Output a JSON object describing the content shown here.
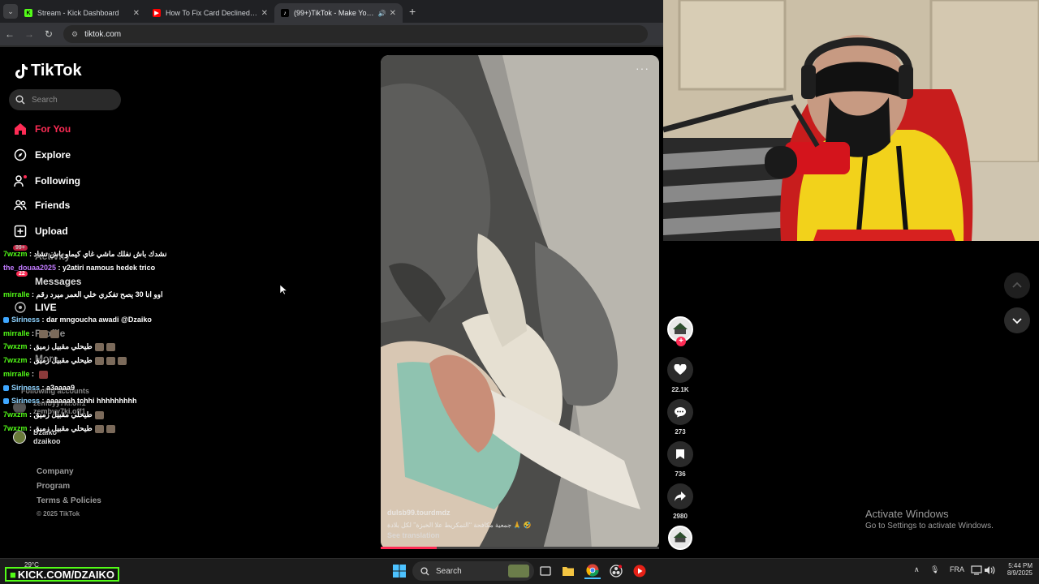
{
  "browser": {
    "tabs": [
      {
        "label": "Stream - Kick Dashboard",
        "active": false
      },
      {
        "label": "How To Fix Card Declined On E",
        "active": false
      },
      {
        "label": "(99+)TikTok - Make Your Da",
        "active": true
      }
    ],
    "url": "tiktok.com"
  },
  "sidebar": {
    "brand": "TikTok",
    "search_placeholder": "Search",
    "nav": [
      {
        "label": "For You",
        "icon": "home-icon",
        "active": true
      },
      {
        "label": "Explore",
        "icon": "compass-icon",
        "active": false
      },
      {
        "label": "Following",
        "icon": "following-icon",
        "active": false
      },
      {
        "label": "Friends",
        "icon": "friends-icon",
        "active": false
      },
      {
        "label": "Upload",
        "icon": "upload-icon",
        "active": false
      },
      {
        "label": "Activity",
        "icon": "activity-icon",
        "badge": "99+"
      },
      {
        "label": "Messages",
        "icon": "messages-icon",
        "badge": "22"
      },
      {
        "label": "LIVE",
        "icon": "live-icon"
      },
      {
        "label": "Profile",
        "icon": "profile-icon"
      },
      {
        "label": "More",
        "icon": "more-icon"
      }
    ],
    "following_accounts_header": "Following accounts",
    "following_accounts": [
      {
        "handle": "zembyy7ki.off1",
        "name": "zembyy7ki.off1"
      },
      {
        "handle": "Dzaiko",
        "name": "dzaikoo"
      }
    ],
    "footer_links": [
      "Company",
      "Program",
      "Terms & Policies"
    ],
    "copyright": "© 2025 TikTok"
  },
  "chat": [
    {
      "user": "7wxzm",
      "message": "نشدك باش نفلك ماشي غاي كيماو ياش تشاد",
      "color": "#53fc18"
    },
    {
      "user": "the_douaa2025",
      "message": "y2atiri namous hedek trico",
      "color": "#c27bff"
    },
    {
      "user": "mirralle",
      "message": "اوو انا 30 يصح تفكري خلي العمر ميرد رقم",
      "color": "#53fc18"
    },
    {
      "user": "Siriness",
      "message": "dar mngoucha awadi @Dzaiko",
      "color": "#8fd3ff"
    },
    {
      "user": "mirralle",
      "message": "",
      "color": "#53fc18"
    },
    {
      "user": "7wxzm",
      "message": "طيحلي مقبيل زميق",
      "color": "#53fc18"
    },
    {
      "user": "7wxzm",
      "message": "طيحلي مقبيل زميق",
      "color": "#53fc18"
    },
    {
      "user": "mirralle",
      "message": "",
      "color": "#53fc18"
    },
    {
      "user": "Siriness",
      "message": "a3aaaa9",
      "color": "#8fd3ff"
    },
    {
      "user": "Siriness",
      "message": "aaaaaah tchhi hhhhhhhhh",
      "color": "#8fd3ff"
    },
    {
      "user": "7wxzm",
      "message": "طيحلي مقبيل زميق",
      "color": "#53fc18"
    },
    {
      "user": "7wxzm",
      "message": "طيحلي مقبيل زميق",
      "color": "#53fc18"
    }
  ],
  "video": {
    "author": "dulsb99.tourdmdz",
    "caption": "جمعية مكافحة ‘‘التمكريط علا الخبزة’’ لكل بلادة 🙏 🤣",
    "see_translation": "See translation",
    "progress_fraction": 0.2
  },
  "actions": {
    "likes": "22.1K",
    "comments": "273",
    "saves": "736",
    "shares": "2980"
  },
  "activate_windows": {
    "title": "Activate Windows",
    "subtitle": "Go to Settings to activate Windows."
  },
  "taskbar": {
    "stream_banner": "KICK.COM/DZAIKO",
    "weather": "29°C",
    "search_placeholder": "Search",
    "language": "FRA",
    "time": "5:44 PM",
    "date": "8/9/2025"
  },
  "colors": {
    "tiktok_red": "#fe2c55",
    "kick_green": "#53fc18"
  }
}
